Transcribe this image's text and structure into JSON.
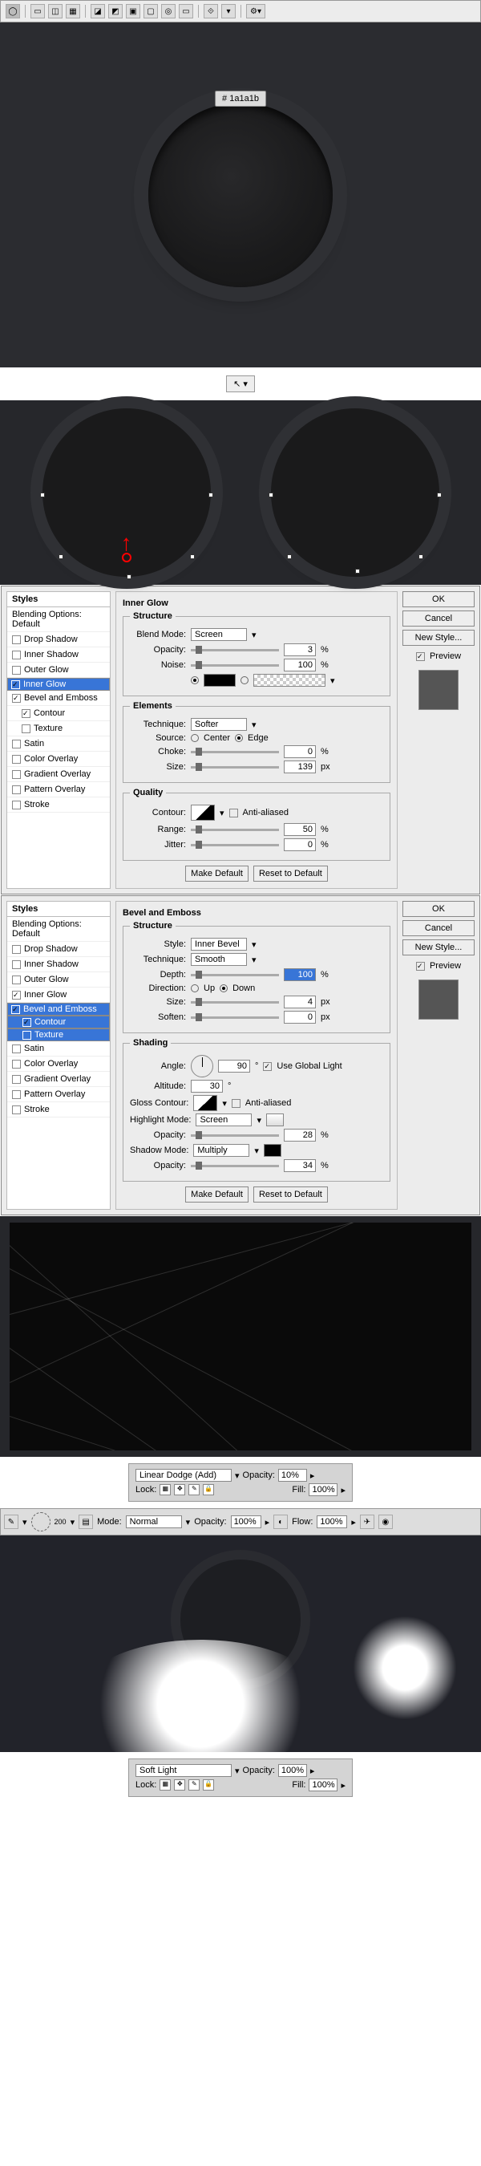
{
  "toolbar": {
    "hex": "# 1a1a1b"
  },
  "cursor_btn": "↖ ▾",
  "dlg1": {
    "title": "Inner Glow",
    "styles_hd": "Styles",
    "blend_opt": "Blending Options: Default",
    "items": [
      "Drop Shadow",
      "Inner Shadow",
      "Outer Glow",
      "Inner Glow",
      "Bevel and Emboss",
      "Contour",
      "Texture",
      "Satin",
      "Color Overlay",
      "Gradient Overlay",
      "Pattern Overlay",
      "Stroke"
    ],
    "structure": "Structure",
    "blend_mode_lbl": "Blend Mode:",
    "blend_mode": "Screen",
    "opacity_lbl": "Opacity:",
    "opacity": "3",
    "pct": "%",
    "noise_lbl": "Noise:",
    "noise": "100",
    "elements": "Elements",
    "technique_lbl": "Technique:",
    "technique": "Softer",
    "source_lbl": "Source:",
    "center": "Center",
    "edge": "Edge",
    "choke_lbl": "Choke:",
    "choke": "0",
    "size_lbl": "Size:",
    "size": "139",
    "px": "px",
    "quality": "Quality",
    "contour_lbl": "Contour:",
    "aa": "Anti-aliased",
    "range_lbl": "Range:",
    "range": "50",
    "jitter_lbl": "Jitter:",
    "jitter": "0",
    "make_def": "Make Default",
    "reset_def": "Reset to Default",
    "ok": "OK",
    "cancel": "Cancel",
    "newstyle": "New Style...",
    "preview": "Preview"
  },
  "dlg2": {
    "title": "Bevel and Emboss",
    "structure": "Structure",
    "style_lbl": "Style:",
    "style": "Inner Bevel",
    "technique_lbl": "Technique:",
    "technique": "Smooth",
    "depth_lbl": "Depth:",
    "depth": "100",
    "direction_lbl": "Direction:",
    "up": "Up",
    "down": "Down",
    "size_lbl": "Size:",
    "size": "4",
    "soften_lbl": "Soften:",
    "soften": "0",
    "shading": "Shading",
    "angle_lbl": "Angle:",
    "angle": "90",
    "ugl": "Use Global Light",
    "altitude_lbl": "Altitude:",
    "altitude": "30",
    "gloss_lbl": "Gloss Contour:",
    "aa": "Anti-aliased",
    "hmode_lbl": "Highlight Mode:",
    "hmode": "Screen",
    "hopacity": "28",
    "smode_lbl": "Shadow Mode:",
    "smode": "Multiply",
    "sopacity": "34",
    "opacity_lbl": "Opacity:",
    "pct": "%",
    "px": "px",
    "make_def": "Make Default",
    "reset_def": "Reset to Default",
    "ok": "OK",
    "cancel": "Cancel",
    "newstyle": "New Style...",
    "preview": "Preview"
  },
  "lp1": {
    "mode": "Linear Dodge (Add)",
    "opacity_lbl": "Opacity:",
    "opacity": "10%",
    "lock": "Lock:",
    "fill_lbl": "Fill:",
    "fill": "100%"
  },
  "brush": {
    "size": "200",
    "mode_lbl": "Mode:",
    "mode": "Normal",
    "opacity_lbl": "Opacity:",
    "opacity": "100%",
    "flow_lbl": "Flow:",
    "flow": "100%"
  },
  "lp2": {
    "mode": "Soft Light",
    "opacity_lbl": "Opacity:",
    "opacity": "100%",
    "lock": "Lock:",
    "fill_lbl": "Fill:",
    "fill": "100%"
  }
}
